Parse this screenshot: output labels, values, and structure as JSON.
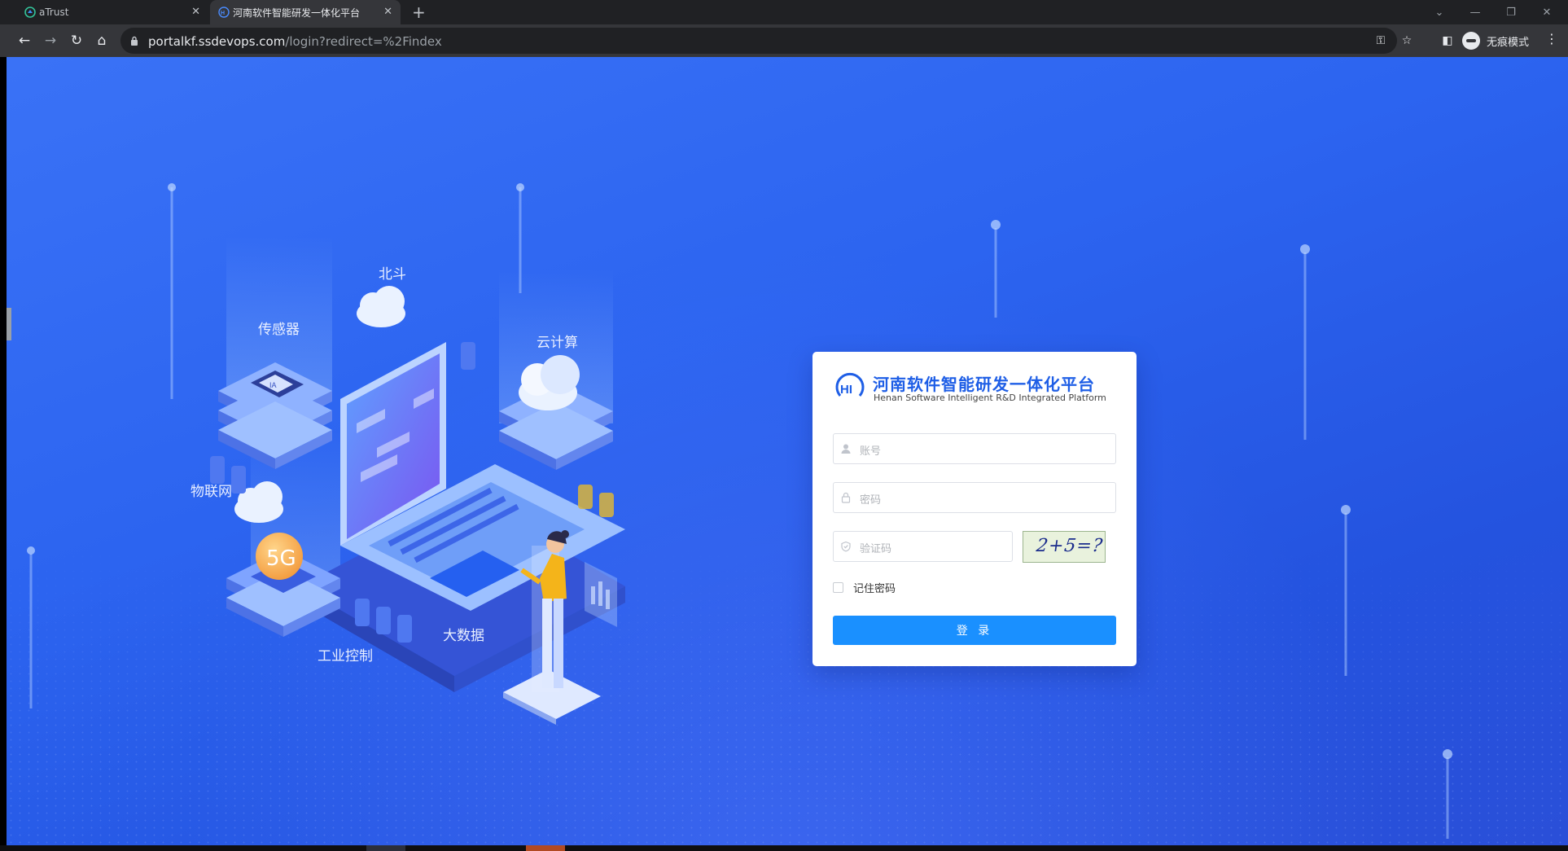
{
  "browser": {
    "tabs": [
      {
        "title": "aTrust",
        "active": false
      },
      {
        "title": "河南软件智能研发一体化平台",
        "active": true
      }
    ],
    "url_host": "portalkf.ssdevops.com",
    "url_path": "/login?redirect=%2Findex",
    "incognito_label": "无痕模式"
  },
  "illustration": {
    "labels": {
      "beidou": "北斗",
      "sensor": "传感器",
      "cloud": "云计算",
      "iot": "物联网",
      "fiveg": "5G",
      "industrial": "工业控制",
      "bigdata": "大数据"
    }
  },
  "login": {
    "brand_cn": "河南软件智能研发一体化平台",
    "brand_en": "Henan Software Intelligent R&D Integrated Platform",
    "account_placeholder": "账号",
    "password_placeholder": "密码",
    "captcha_placeholder": "验证码",
    "captcha_text": "2+5=?",
    "remember_label": "记住密码",
    "submit_label": "登 录"
  },
  "colors": {
    "page_bg": "#2c64f0",
    "brand": "#1e5ee6",
    "button": "#1a90ff"
  }
}
